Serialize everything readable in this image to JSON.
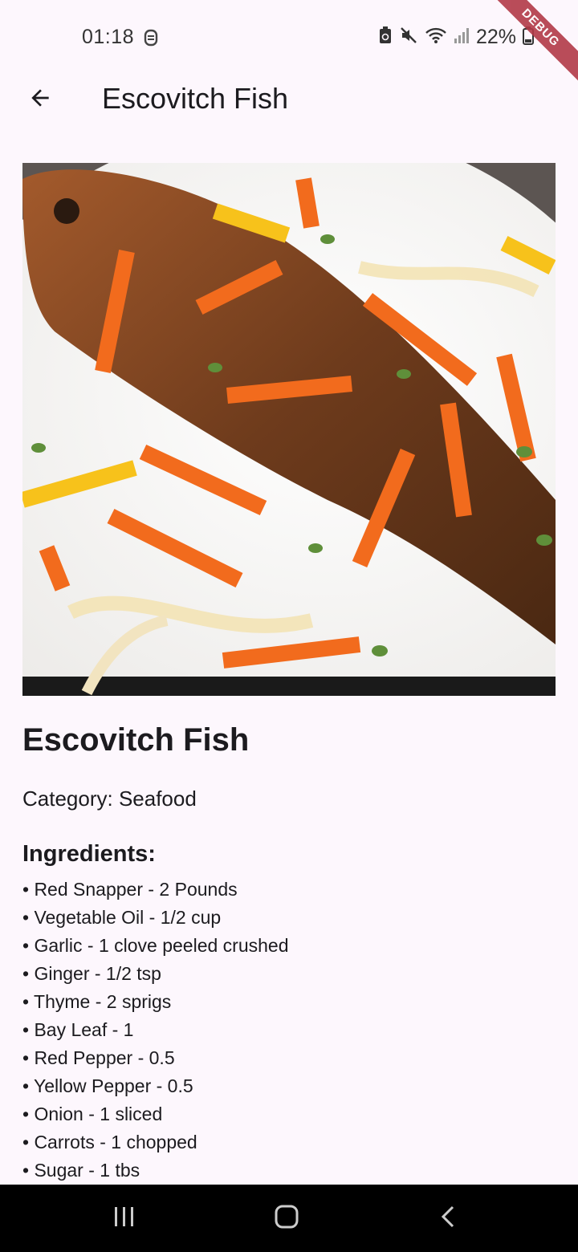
{
  "status_bar": {
    "time": "01:18",
    "battery_percent": "22%"
  },
  "debug_banner": "DEBUG",
  "app_bar": {
    "title": "Escovitch Fish",
    "back_icon": "arrow-back-icon"
  },
  "recipe": {
    "title": "Escovitch Fish",
    "category": "Category: Seafood",
    "ingredients_heading": "Ingredients:",
    "ingredients": [
      "• Red Snapper - 2 Pounds",
      "• Vegetable Oil - 1/2 cup",
      "• Garlic - 1 clove peeled crushed",
      "• Ginger - 1/2 tsp",
      "• Thyme - 2 sprigs",
      "• Bay Leaf - 1",
      "• Red Pepper - 0.5",
      "• Yellow Pepper - 0.5",
      "• Onion - 1 sliced",
      "• Carrots - 1 chopped",
      "• Sugar - 1 tbs"
    ]
  },
  "nav_bar": {
    "recents_icon": "recents-icon",
    "home_icon": "home-icon",
    "back_icon": "back-chevron-icon"
  }
}
